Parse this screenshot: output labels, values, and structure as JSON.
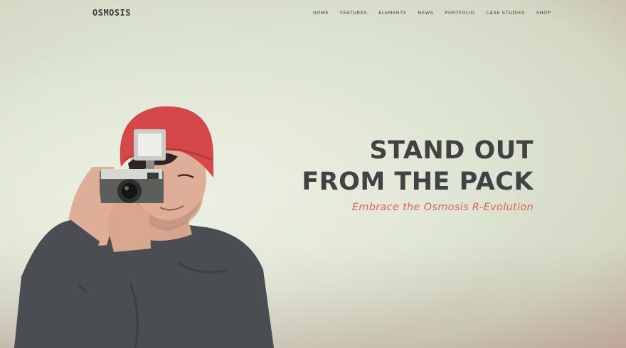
{
  "brand": {
    "logo": "OSMOSIS"
  },
  "nav": {
    "items": [
      {
        "label": "HOME"
      },
      {
        "label": "FEATURES"
      },
      {
        "label": "ELEMENTS"
      },
      {
        "label": "NEWS"
      },
      {
        "label": "PORTFOLIO"
      },
      {
        "label": "CASE STUDIES"
      },
      {
        "label": "SHOP"
      }
    ]
  },
  "hero": {
    "headline_line1": "STAND OUT",
    "headline_line2": "FROM THE PACK",
    "tagline": "Embrace the Osmosis R-Evolution"
  },
  "colors": {
    "accent": "#e0625a",
    "headline": "#404342",
    "background": "#dde3d1",
    "beanie": "#d4484a",
    "shirt": "#4a4d52"
  },
  "icons": {
    "hero_image": "photographer-with-camera-photo"
  }
}
